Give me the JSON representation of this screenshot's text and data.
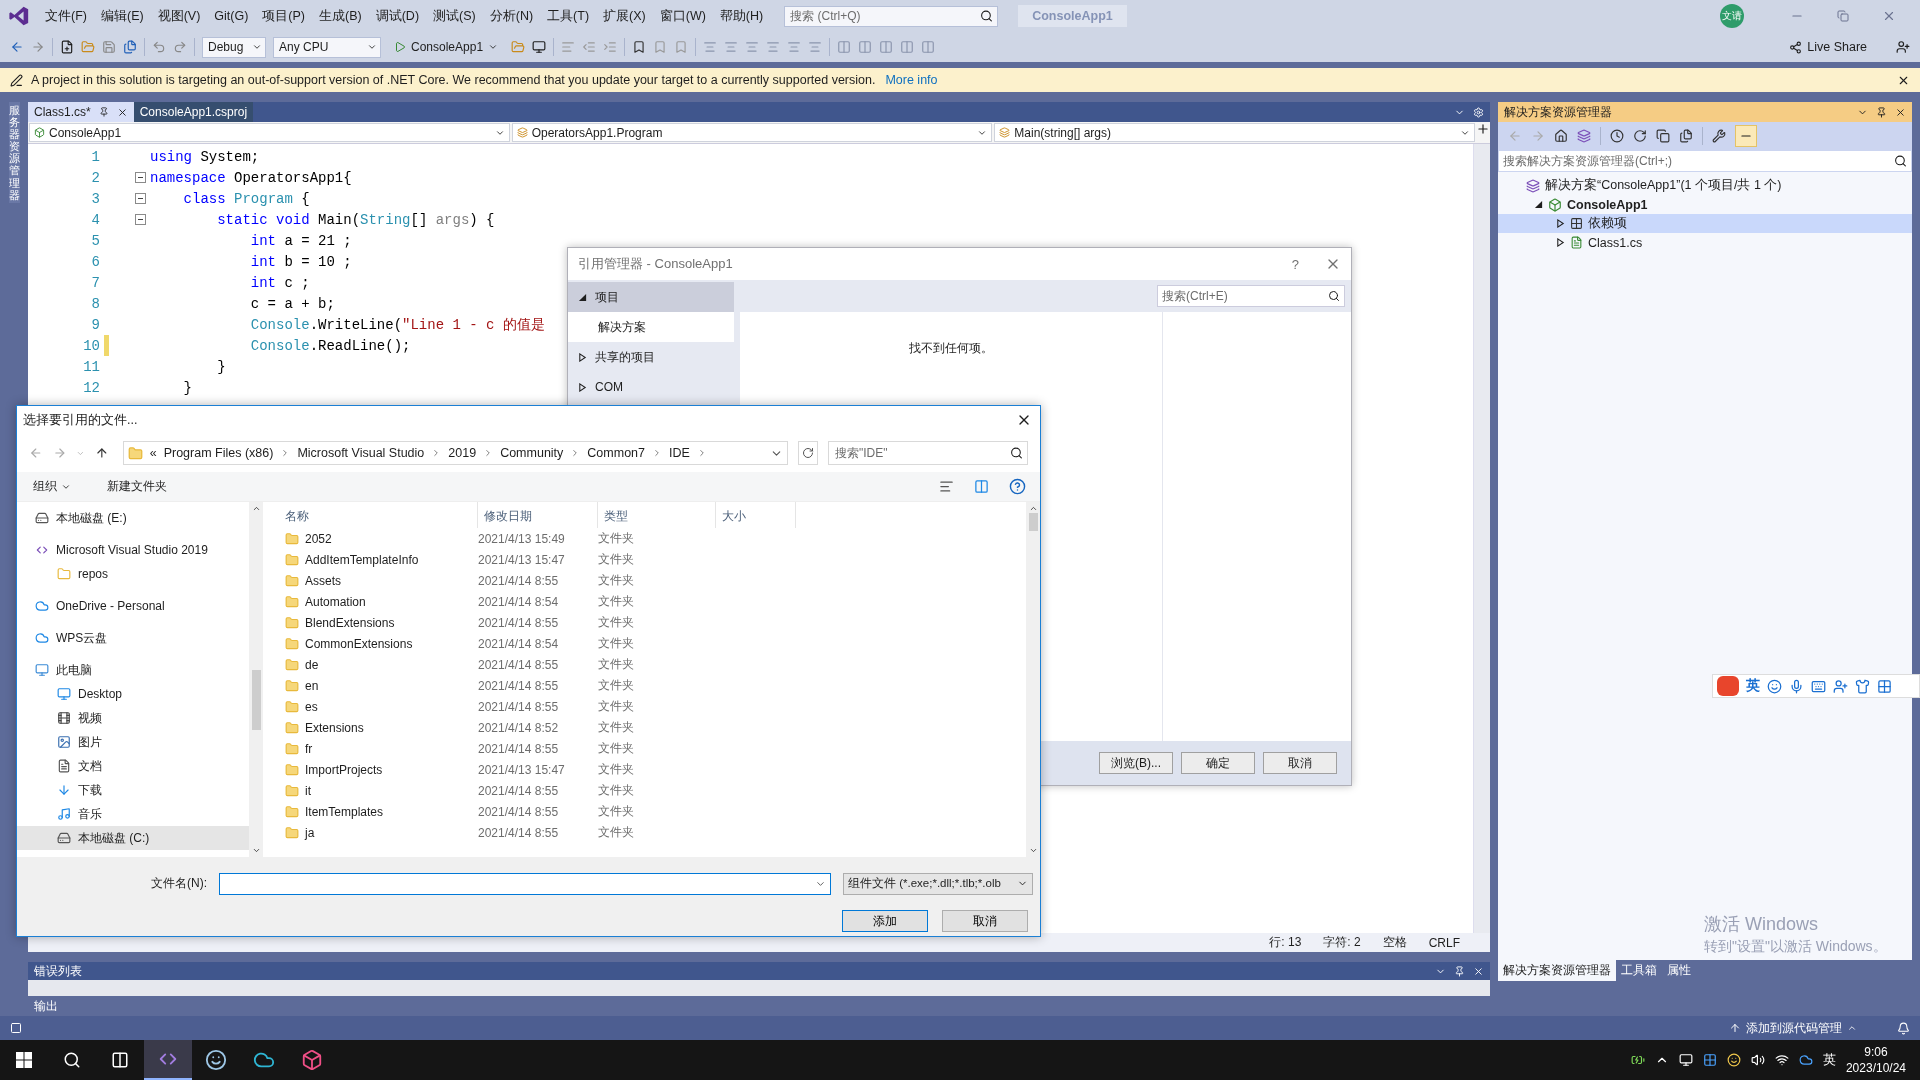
{
  "menu": [
    "文件(F)",
    "编辑(E)",
    "视图(V)",
    "Git(G)",
    "项目(P)",
    "生成(B)",
    "调试(D)",
    "测试(S)",
    "分析(N)",
    "工具(T)",
    "扩展(X)",
    "窗口(W)",
    "帮助(H)"
  ],
  "search": {
    "placeholder": "搜索 (Ctrl+Q)"
  },
  "solution_name": "ConsoleApp1",
  "avatar": "文请",
  "toolbar": {
    "configuration": "Debug",
    "platform": "Any CPU",
    "start": "ConsoleApp1",
    "live_share": "Live Share"
  },
  "info_bar": {
    "message": "A project in this solution is targeting an out-of-support version of .NET Core. We recommend that you update your target to a currently supported version.",
    "link": "More info"
  },
  "side_tab": "服务器资源管理器",
  "tabs": [
    {
      "label": "Class1.cs*",
      "selected": true
    },
    {
      "label": "ConsoleApp1.csproj",
      "selected": false
    }
  ],
  "nav": [
    "ConsoleApp1",
    "OperatorsApp1.Program",
    "Main(string[] args)"
  ],
  "code": [
    {
      "number": "1",
      "fold": false,
      "changed": false,
      "tokens": [
        {
          "kind": "keyword",
          "text": "using"
        },
        {
          "kind": "plain",
          "text": " System;"
        }
      ]
    },
    {
      "number": "2",
      "fold": true,
      "changed": false,
      "tokens": [
        {
          "kind": "keyword",
          "text": "namespace"
        },
        {
          "kind": "plain",
          "text": " OperatorsApp1{"
        }
      ]
    },
    {
      "number": "3",
      "fold": true,
      "changed": false,
      "tokens": [
        {
          "kind": "keyword",
          "text": "    class"
        },
        {
          "kind": "type",
          "text": " Program"
        },
        {
          "kind": "plain",
          "text": " {"
        }
      ]
    },
    {
      "number": "4",
      "fold": true,
      "changed": false,
      "tokens": [
        {
          "kind": "keyword",
          "text": "        static void"
        },
        {
          "kind": "plain",
          "text": " Main("
        },
        {
          "kind": "type",
          "text": "String"
        },
        {
          "kind": "plain",
          "text": "[] "
        },
        {
          "kind": "param",
          "text": "args"
        },
        {
          "kind": "plain",
          "text": ") {"
        }
      ]
    },
    {
      "number": "5",
      "fold": false,
      "changed": false,
      "tokens": [
        {
          "kind": "keyword",
          "text": "            int"
        },
        {
          "kind": "plain",
          "text": " a = 21 ;"
        }
      ]
    },
    {
      "number": "6",
      "fold": false,
      "changed": false,
      "tokens": [
        {
          "kind": "keyword",
          "text": "            int"
        },
        {
          "kind": "plain",
          "text": " b = 10 ;"
        }
      ]
    },
    {
      "number": "7",
      "fold": false,
      "changed": false,
      "tokens": [
        {
          "kind": "keyword",
          "text": "            int"
        },
        {
          "kind": "plain",
          "text": " c ;"
        }
      ]
    },
    {
      "number": "8",
      "fold": false,
      "changed": false,
      "tokens": [
        {
          "kind": "plain",
          "text": "            c = a + b;"
        }
      ]
    },
    {
      "number": "9",
      "fold": false,
      "changed": false,
      "tokens": [
        {
          "kind": "type",
          "text": "            Console"
        },
        {
          "kind": "plain",
          "text": ".WriteLine("
        },
        {
          "kind": "string",
          "text": "\"Line 1 - c 的值是"
        }
      ]
    },
    {
      "number": "10",
      "fold": false,
      "changed": true,
      "tokens": [
        {
          "kind": "type",
          "text": "            Console"
        },
        {
          "kind": "plain",
          "text": ".ReadLine();"
        }
      ]
    },
    {
      "number": "11",
      "fold": false,
      "changed": false,
      "tokens": [
        {
          "kind": "plain",
          "text": "        }"
        }
      ]
    },
    {
      "number": "12",
      "fold": false,
      "changed": false,
      "tokens": [
        {
          "kind": "plain",
          "text": "    }"
        }
      ]
    }
  ],
  "editor_status": [
    "行: 13",
    "字符: 2",
    "空格",
    "CRLF"
  ],
  "error_list": {
    "title": "错误列表"
  },
  "output_tab": "输出",
  "solution_explorer": {
    "title": "解决方案资源管理器",
    "search": {
      "placeholder": "搜索解决方案资源管理器(Ctrl+;)"
    },
    "tree": [
      {
        "label": "解决方案“ConsoleApp1”(1 个项目/共 1 个)",
        "kind": "solution",
        "selected": false,
        "children": [
          {
            "label": "ConsoleApp1",
            "kind": "project",
            "expanded": true,
            "selected": false,
            "children": [
              {
                "label": "依赖项",
                "kind": "dependencies",
                "expanded": false,
                "selected": true
              },
              {
                "label": "Class1.cs",
                "kind": "csharp",
                "expanded": false,
                "selected": false
              }
            ]
          }
        ]
      }
    ],
    "tabs": [
      {
        "label": "解决方案资源管理器",
        "selected": true
      },
      {
        "label": "工具箱",
        "selected": false
      },
      {
        "label": "属性",
        "selected": false
      }
    ]
  },
  "status_bar": {
    "source_control": "添加到源代码管理"
  },
  "ref_manager": {
    "title": "引用管理器 - ConsoleApp1",
    "help": "?",
    "categories": [
      {
        "label": "项目",
        "expanded": true,
        "children": [
          {
            "label": "解决方案"
          }
        ]
      },
      {
        "label": "共享的项目",
        "expanded": false
      },
      {
        "label": "COM",
        "expanded": false
      }
    ],
    "search": {
      "placeholder": "搜索(Ctrl+E)"
    },
    "empty_message": "找不到任何项。",
    "buttons": [
      "浏览(B)...",
      "确定",
      "取消"
    ]
  },
  "file_dialog": {
    "title": "选择要引用的文件...",
    "breadcrumb": [
      "«",
      "Program Files (x86)",
      "Microsoft Visual Studio",
      "2019",
      "Community",
      "Common7",
      "IDE"
    ],
    "search": {
      "placeholder": "搜索\"IDE\""
    },
    "organize": "组织",
    "new_folder": "新建文件夹",
    "nav": [
      {
        "label": "本地磁盘 (E:)",
        "kind": "drive",
        "selected": false
      },
      {
        "label": "Microsoft Visual Studio 2019",
        "kind": "vs",
        "selected": false,
        "children": [
          {
            "label": "repos",
            "kind": "folder",
            "selected": false
          }
        ]
      },
      {
        "label": "OneDrive - Personal",
        "kind": "cloud",
        "selected": false
      },
      {
        "label": "WPS云盘",
        "kind": "cloud",
        "selected": false
      },
      {
        "label": "此电脑",
        "kind": "pc",
        "selected": false,
        "children": [
          {
            "label": "Desktop",
            "kind": "desktop",
            "selected": false
          },
          {
            "label": "视频",
            "kind": "video",
            "selected": false
          },
          {
            "label": "图片",
            "kind": "picture",
            "selected": false
          },
          {
            "label": "文档",
            "kind": "document",
            "selected": false
          },
          {
            "label": "下载",
            "kind": "download",
            "selected": false
          },
          {
            "label": "音乐",
            "kind": "music",
            "selected": false
          },
          {
            "label": "本地磁盘 (C:)",
            "kind": "drive",
            "selected": true
          }
        ]
      }
    ],
    "columns": [
      "名称",
      "修改日期",
      "类型",
      "大小"
    ],
    "files": [
      {
        "name": "2052",
        "modified": "2021/4/13 15:49",
        "type": "文件夹"
      },
      {
        "name": "AddItemTemplateInfo",
        "modified": "2021/4/13 15:47",
        "type": "文件夹"
      },
      {
        "name": "Assets",
        "modified": "2021/4/14 8:55",
        "type": "文件夹"
      },
      {
        "name": "Automation",
        "modified": "2021/4/14 8:54",
        "type": "文件夹"
      },
      {
        "name": "BlendExtensions",
        "modified": "2021/4/14 8:55",
        "type": "文件夹"
      },
      {
        "name": "CommonExtensions",
        "modified": "2021/4/14 8:54",
        "type": "文件夹"
      },
      {
        "name": "de",
        "modified": "2021/4/14 8:55",
        "type": "文件夹"
      },
      {
        "name": "en",
        "modified": "2021/4/14 8:55",
        "type": "文件夹"
      },
      {
        "name": "es",
        "modified": "2021/4/14 8:55",
        "type": "文件夹"
      },
      {
        "name": "Extensions",
        "modified": "2021/4/14 8:52",
        "type": "文件夹"
      },
      {
        "name": "fr",
        "modified": "2021/4/14 8:55",
        "type": "文件夹"
      },
      {
        "name": "ImportProjects",
        "modified": "2021/4/13 15:47",
        "type": "文件夹"
      },
      {
        "name": "it",
        "modified": "2021/4/14 8:55",
        "type": "文件夹"
      },
      {
        "name": "ItemTemplates",
        "modified": "2021/4/14 8:55",
        "type": "文件夹"
      },
      {
        "name": "ja",
        "modified": "2021/4/14 8:55",
        "type": "文件夹"
      }
    ],
    "filename_label": "文件名(N):",
    "filter": "组件文件 (*.exe;*.dll;*.tlb;*.olb",
    "buttons": [
      "添加",
      "取消"
    ]
  },
  "ime_bar": {
    "mode": "英"
  },
  "activation": {
    "title": "激活 Windows",
    "hint": "转到\"设置\"以激活 Windows。"
  },
  "taskbar": {
    "ime": "英",
    "time": "9:06",
    "date": "2023/10/24"
  }
}
